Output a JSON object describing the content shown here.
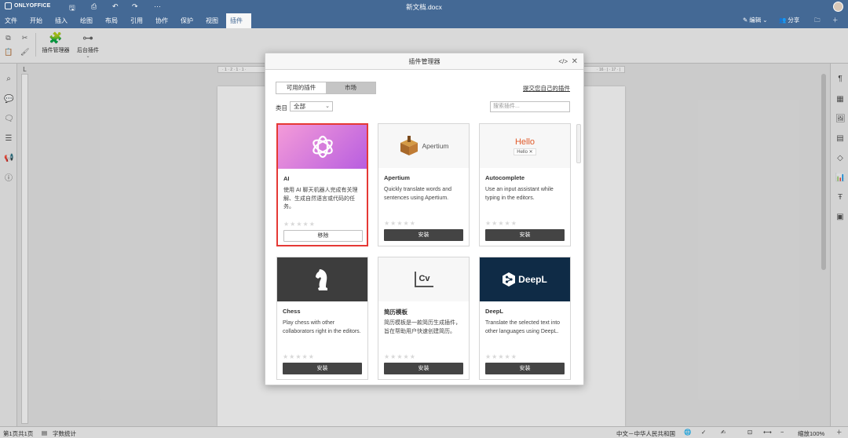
{
  "app": {
    "brand": "ONLYOFFICE",
    "doc_title": "新文档.docx"
  },
  "menu": {
    "tabs": [
      "文件",
      "开始",
      "插入",
      "绘图",
      "布局",
      "引用",
      "协作",
      "保护",
      "视图",
      "插件"
    ],
    "active_tab": "插件",
    "edit_label": "编辑",
    "share_label": "分享"
  },
  "toolbar": {
    "plugin_manager_label": "插件管理器",
    "background_plugins_label": "后台插件"
  },
  "dialog": {
    "title": "插件管理器",
    "tabs": [
      "可用的插件",
      "市场"
    ],
    "active_tab": "市场",
    "submit_link": "提交您自己的插件",
    "category_label": "类目",
    "category_value": "全部",
    "search_placeholder": "搜索插件...",
    "plugins": [
      {
        "name": "AI",
        "desc": "使用 AI 聊天机器人完成有关理解、生成自然语言或代码的任务。",
        "button": "移除",
        "selected": true,
        "icon": "openai-icon"
      },
      {
        "name": "Apertium",
        "desc": "Quickly translate words and sentences using Apertium.",
        "button": "安装",
        "selected": false,
        "icon": "apertium-logo",
        "logo_text": "Apertium"
      },
      {
        "name": "Autocomplete",
        "desc": "Use an input assistant while typing in the editors.",
        "button": "安装",
        "selected": false,
        "icon": "autocomplete-preview",
        "preview_text": "Hello",
        "preview_chip": "Hello"
      },
      {
        "name": "Chess",
        "desc": "Play chess with other collaborators right in the editors.",
        "button": "安装",
        "selected": false,
        "icon": "chess-knight-icon"
      },
      {
        "name": "简历模板",
        "desc": "简历模板是一款简历生成插件，旨在帮助用户快速创建简历。",
        "button": "安装",
        "selected": false,
        "icon": "cv-icon",
        "logo_text": "Cv"
      },
      {
        "name": "DeepL",
        "desc": "Translate the selected text into other languages using DeepL.",
        "button": "安装",
        "selected": false,
        "icon": "deepl-logo",
        "logo_text": "DeepL"
      }
    ]
  },
  "ruler": {
    "left_text": "· 1 · 2 · 1 · 1 ·",
    "right_text": "· 16 · | · 17 · |"
  },
  "status": {
    "page_info": "第1页共1页",
    "word_count": "字数统计",
    "language": "中文－中华人民共和国",
    "zoom": "缩放100%"
  }
}
